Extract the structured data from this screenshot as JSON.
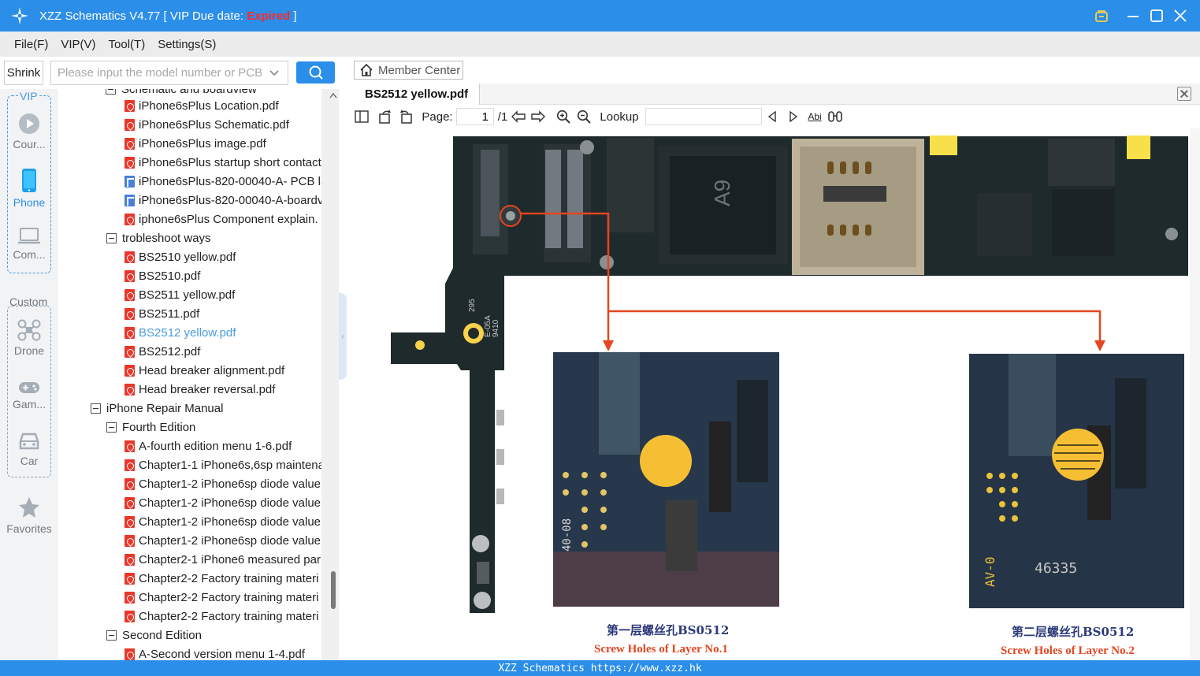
{
  "window": {
    "title": "XZZ Schematics V4.77 [ VIP Due date: ",
    "expired_label": "Expired",
    "title_end": " ]"
  },
  "menu": [
    "File(F)",
    "VIP(V)",
    "Tool(T)",
    "Settings(S)"
  ],
  "search": {
    "shrink_label": "Shrink",
    "placeholder": "Please input the model number or PCB",
    "value": ""
  },
  "categories": {
    "vip_label": "VIP",
    "custom_label": "Custom",
    "items": [
      {
        "label": "Cour...",
        "icon": "play-icon"
      },
      {
        "label": "Phone",
        "icon": "phone-icon"
      },
      {
        "label": "Com...",
        "icon": "laptop-icon"
      },
      {
        "label": "Drone",
        "icon": "drone-icon"
      },
      {
        "label": "Gam...",
        "icon": "gamepad-icon"
      },
      {
        "label": "Car",
        "icon": "car-icon"
      },
      {
        "label": "Favorites",
        "icon": "star-icon"
      }
    ]
  },
  "tree": [
    {
      "label": "Schematic and boardview",
      "type": "folder"
    },
    {
      "label": "iPhone6sPlus Location.pdf",
      "type": "pdf"
    },
    {
      "label": "iPhone6sPlus Schematic.pdf",
      "type": "pdf"
    },
    {
      "label": "iPhone6sPlus image.pdf",
      "type": "pdf"
    },
    {
      "label": "iPhone6sPlus startup short contact",
      "type": "pdf"
    },
    {
      "label": "iPhone6sPlus-820-00040-A- PCB la",
      "type": "pcb"
    },
    {
      "label": "iPhone6sPlus-820-00040-A-boardv",
      "type": "pcb"
    },
    {
      "label": "iphone6sPlus Component explain.",
      "type": "pdf"
    },
    {
      "label": "trobleshoot ways",
      "type": "folder"
    },
    {
      "label": "BS2510 yellow.pdf",
      "type": "pdf"
    },
    {
      "label": "BS2510.pdf",
      "type": "pdf"
    },
    {
      "label": "BS2511 yellow.pdf",
      "type": "pdf"
    },
    {
      "label": "BS2511.pdf",
      "type": "pdf"
    },
    {
      "label": "BS2512 yellow.pdf",
      "type": "pdf",
      "selected": true
    },
    {
      "label": "BS2512.pdf",
      "type": "pdf"
    },
    {
      "label": "Head breaker alignment.pdf",
      "type": "pdf"
    },
    {
      "label": "Head breaker reversal.pdf",
      "type": "pdf"
    },
    {
      "label": "iPhone Repair Manual",
      "type": "folder"
    },
    {
      "label": "Fourth Edition",
      "type": "folder"
    },
    {
      "label": "A-fourth edition menu 1-6.pdf",
      "type": "pdf"
    },
    {
      "label": "Chapter1-1 iPhone6s,6sp maintena",
      "type": "pdf"
    },
    {
      "label": "Chapter1-2 iPhone6sp diode value",
      "type": "pdf"
    },
    {
      "label": "Chapter1-2 iPhone6sp diode value",
      "type": "pdf"
    },
    {
      "label": "Chapter1-2 iPhone6sp diode value",
      "type": "pdf"
    },
    {
      "label": "Chapter1-2 iPhone6sp diode value",
      "type": "pdf"
    },
    {
      "label": "Chapter2-1 iPhone6 measured par",
      "type": "pdf"
    },
    {
      "label": "Chapter2-2 Factory training materi",
      "type": "pdf"
    },
    {
      "label": "Chapter2-2 Factory training materi",
      "type": "pdf"
    },
    {
      "label": "Chapter2-2 Factory training materi",
      "type": "pdf"
    },
    {
      "label": "Second Edition",
      "type": "folder"
    },
    {
      "label": "A-Second version menu 1-4.pdf",
      "type": "pdf"
    }
  ],
  "member_center_label": "Member Center",
  "tab": {
    "label": "BS2512 yellow.pdf"
  },
  "toolbar": {
    "page_label": "Page:",
    "page_value": "1",
    "page_total": "/1",
    "lookup_label": "Lookup",
    "lookup_value": "",
    "abi_label": "Abi"
  },
  "document": {
    "chip_label": "A9",
    "board_text_1": "295",
    "board_text_2": "E-05A",
    "board_text_3": "9410",
    "photo1_text": "40-08",
    "photo2_text_1": "46335",
    "photo2_text_2": "AV-0",
    "caption1_cn": "第一层螺丝孔BS0512",
    "caption1_en": "Screw Holes of Layer No.1",
    "caption2_cn": "第二层螺丝孔BS0512",
    "caption2_en": "Screw Holes of Layer No.2"
  },
  "status": {
    "text": "XZZ Schematics https://www.xzz.hk"
  },
  "colors": {
    "accent": "#2b8ee8",
    "expired": "#ff2a2a",
    "arrow": "#e6451f",
    "pad": "#f7c437"
  }
}
